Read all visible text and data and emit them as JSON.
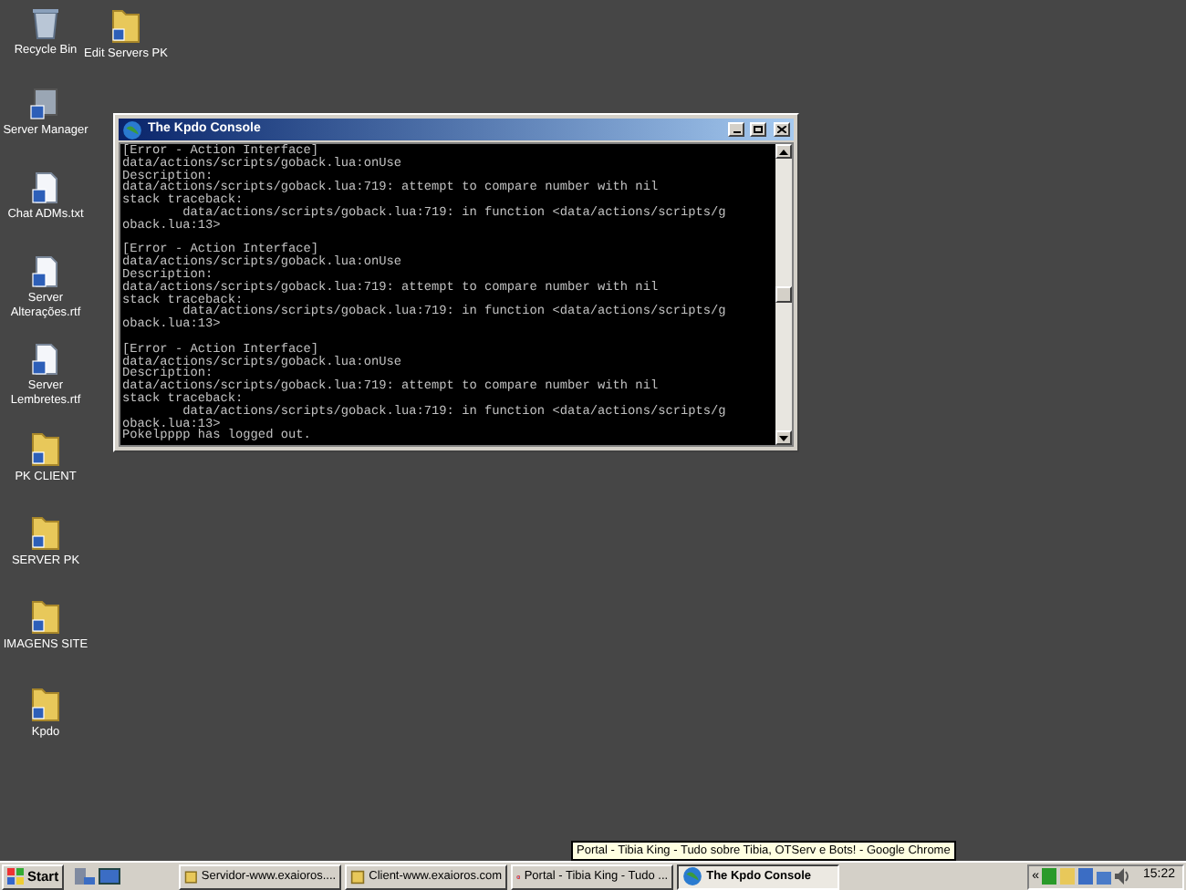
{
  "desktop_icons": [
    {
      "label": "Recycle Bin",
      "kind": "bin"
    },
    {
      "label": "Edit Servers PK",
      "kind": "folder"
    },
    {
      "label": "Server Manager",
      "kind": "app"
    },
    {
      "label": "Chat ADMs.txt",
      "kind": "doc"
    },
    {
      "label": "Server Alterações.rtf",
      "kind": "doc"
    },
    {
      "label": "Server Lembretes.rtf",
      "kind": "doc"
    },
    {
      "label": "PK CLIENT",
      "kind": "folder"
    },
    {
      "label": "SERVER PK",
      "kind": "folder"
    },
    {
      "label": "IMAGENS SITE",
      "kind": "folder"
    },
    {
      "label": "Kpdo",
      "kind": "folder"
    }
  ],
  "window": {
    "title": "The Kpdo Console",
    "lines": [
      {
        "text": "[Error - Action Interface]",
        "gap_before": false
      },
      {
        "text": "data/actions/scripts/goback.lua:onUse",
        "gap_before": false
      },
      {
        "text": "Description:",
        "gap_before": false
      },
      {
        "text": "data/actions/scripts/goback.lua:719: attempt to compare number with nil",
        "gap_before": false
      },
      {
        "text": "stack traceback:",
        "gap_before": false
      },
      {
        "text": "        data/actions/scripts/goback.lua:719: in function <data/actions/scripts/g",
        "gap_before": false
      },
      {
        "text": "oback.lua:13>",
        "gap_before": false
      },
      {
        "text": "[Error - Action Interface]",
        "gap_before": true
      },
      {
        "text": "data/actions/scripts/goback.lua:onUse",
        "gap_before": false
      },
      {
        "text": "Description:",
        "gap_before": false
      },
      {
        "text": "data/actions/scripts/goback.lua:719: attempt to compare number with nil",
        "gap_before": false
      },
      {
        "text": "stack traceback:",
        "gap_before": false
      },
      {
        "text": "        data/actions/scripts/goback.lua:719: in function <data/actions/scripts/g",
        "gap_before": false
      },
      {
        "text": "oback.lua:13>",
        "gap_before": false
      },
      {
        "text": "[Error - Action Interface]",
        "gap_before": true
      },
      {
        "text": "data/actions/scripts/goback.lua:onUse",
        "gap_before": false
      },
      {
        "text": "Description:",
        "gap_before": false
      },
      {
        "text": "data/actions/scripts/goback.lua:719: attempt to compare number with nil",
        "gap_before": false
      },
      {
        "text": "stack traceback:",
        "gap_before": false
      },
      {
        "text": "        data/actions/scripts/goback.lua:719: in function <data/actions/scripts/g",
        "gap_before": false
      },
      {
        "text": "oback.lua:13>",
        "gap_before": false
      },
      {
        "text": "Pokelpppp has logged out.",
        "gap_before": false
      }
    ]
  },
  "tooltip": "Portal - Tibia King - Tudo sobre Tibia, OTServ e Bots! - Google Chrome",
  "taskbar": {
    "start": "Start",
    "tasks": [
      {
        "label": "Servidor-www.exaioros....",
        "selected": false,
        "kind": "app"
      },
      {
        "label": "Client-www.exaioros.com",
        "selected": false,
        "kind": "app"
      },
      {
        "label": "Portal - Tibia King - Tudo ...",
        "selected": false,
        "kind": "browser"
      },
      {
        "label": "The Kpdo Console",
        "selected": true,
        "kind": "console"
      }
    ],
    "tray_toggle": "«",
    "clock": "15:22"
  }
}
